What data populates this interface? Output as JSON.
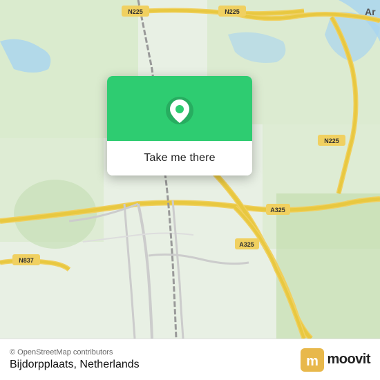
{
  "map": {
    "background_color": "#e8f0e8"
  },
  "popup": {
    "button_label": "Take me there",
    "pin_color": "#ffffff",
    "card_bg_color": "#2ecc71"
  },
  "bottom_bar": {
    "credit": "© OpenStreetMap contributors",
    "location_name": "Bijdorpplaats, Netherlands",
    "moovit_label": "moovit"
  }
}
